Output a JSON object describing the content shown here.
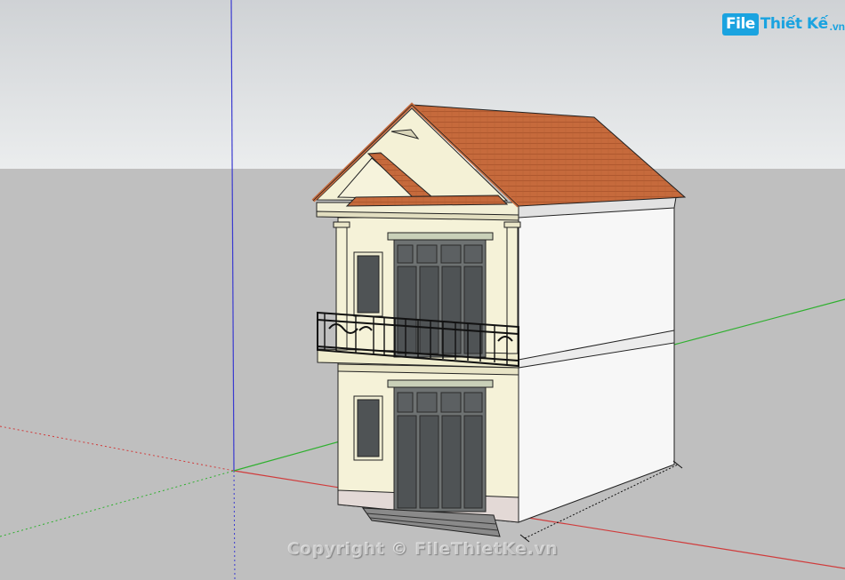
{
  "logo": {
    "badge": "File",
    "name": "Thiết Kế",
    "domain": ".vn"
  },
  "watermark": "Copyright © FileThietKe.vn",
  "colors": {
    "sky": "#e4e6e8",
    "ground": "#bfbfbf",
    "roof": "#c96a3e",
    "wall_side": "#f7f7f7",
    "wall_front": "#f5f2d8",
    "axis_red": "#d03b3b",
    "axis_green": "#2fb02f",
    "axis_blue": "#3a3ad0",
    "accent": "#1aa3e0"
  }
}
